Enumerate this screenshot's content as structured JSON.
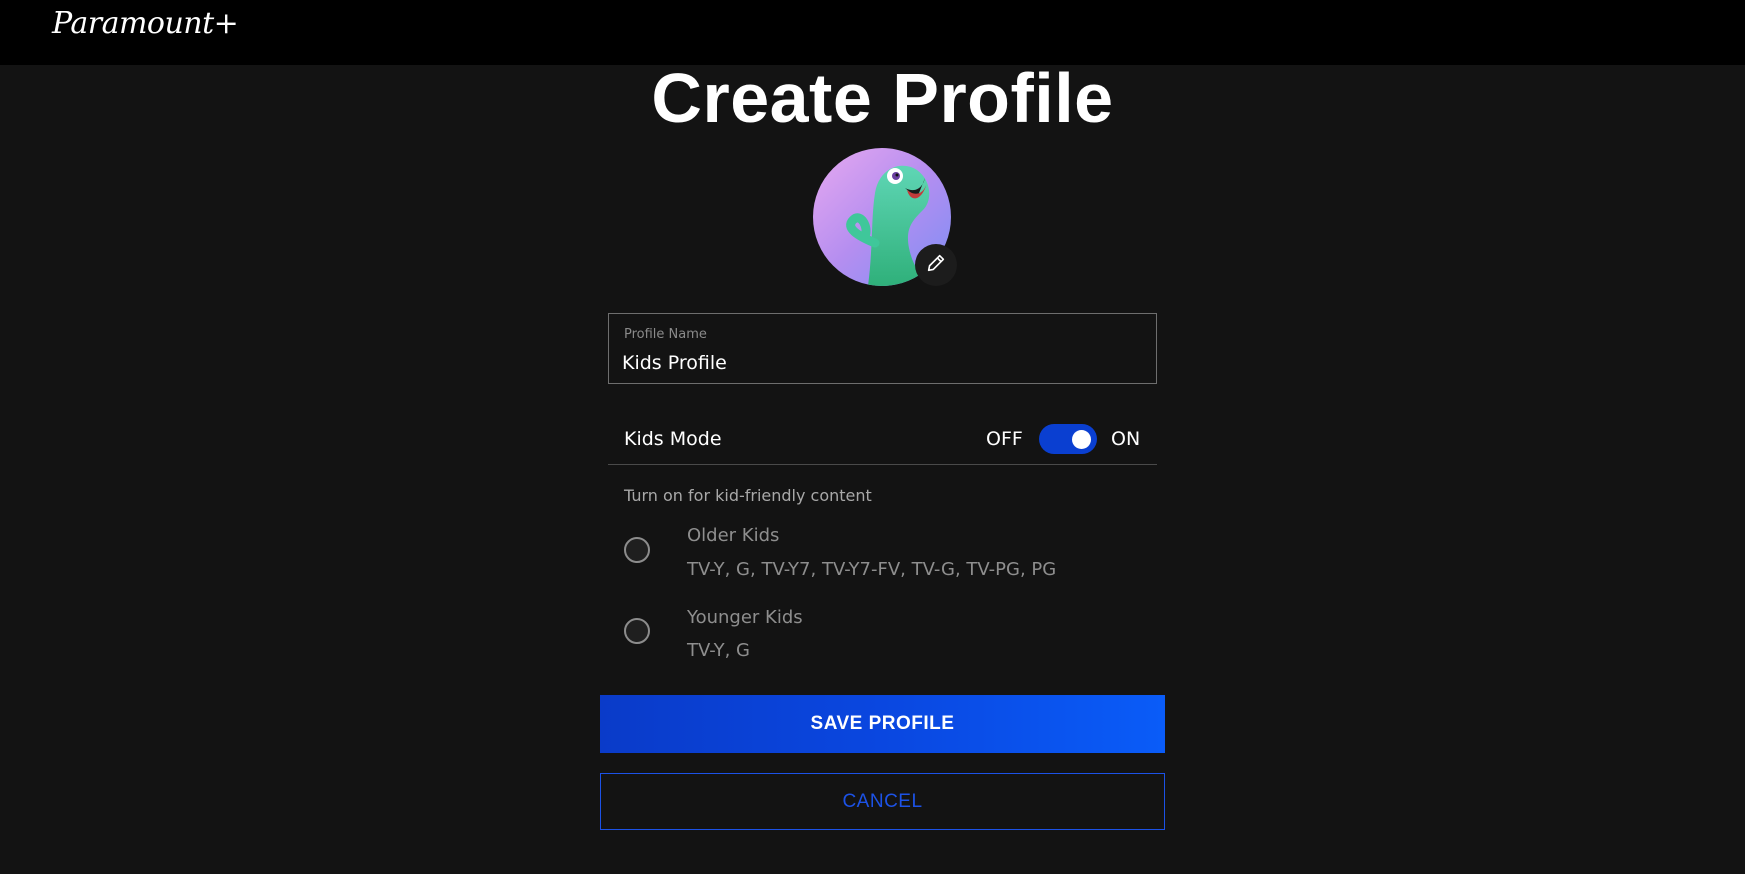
{
  "header": {
    "logo_text": "Paramount+"
  },
  "page": {
    "title": "Create Profile"
  },
  "avatar": {
    "icon": "pencil-icon"
  },
  "profile_name": {
    "label": "Profile Name",
    "value": "Kids Profile"
  },
  "kids_mode": {
    "label": "Kids Mode",
    "off_label": "OFF",
    "on_label": "ON",
    "enabled": true
  },
  "hint": "Turn on for kid-friendly content",
  "options": [
    {
      "title": "Older Kids",
      "ratings": "TV-Y, G, TV-Y7, TV-Y7-FV, TV-G, TV-PG, PG",
      "selected": false
    },
    {
      "title": "Younger Kids",
      "ratings": "TV-Y, G",
      "selected": false
    }
  ],
  "actions": {
    "save_label": "SAVE PROFILE",
    "cancel_label": "CANCEL"
  },
  "colors": {
    "accent": "#0a47e0",
    "background": "#131313",
    "header": "#000000"
  }
}
